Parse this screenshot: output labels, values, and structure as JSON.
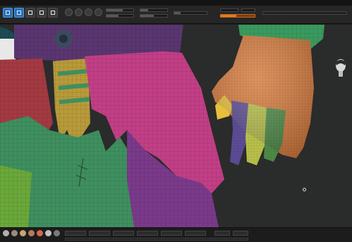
{
  "colors": {
    "accent_blue": "#2b6fb0",
    "accent_orange": "#e07a22",
    "viewport_bg": "#2a2b2b",
    "purple_cloth": "#5a3670",
    "magenta_cloth": "#c23f86",
    "red_cloth": "#a33a42",
    "green_cloth": "#3f8f5f",
    "lime_cloth": "#6aa83a",
    "yellow_stripe": "#b89a3a",
    "hand_orange": "#d67a3c",
    "finger_purple": "#5c4c94",
    "finger_yellow": "#b8c04a",
    "finger_green": "#4e8a46",
    "sleeve_green": "#3a9a5e"
  },
  "icons": {
    "toolbar": [
      "edit-icon",
      "draw-icon",
      "move-icon",
      "scale-icon",
      "rotate-icon"
    ],
    "viewport": [
      "avatar-icon",
      "cursor-icon"
    ]
  },
  "materials": [
    "#b0b0b0",
    "#9a8a7a",
    "#c8a27a",
    "#b87a5a",
    "#d06a4a",
    "#c0c0c0",
    "#7a7a7a"
  ]
}
